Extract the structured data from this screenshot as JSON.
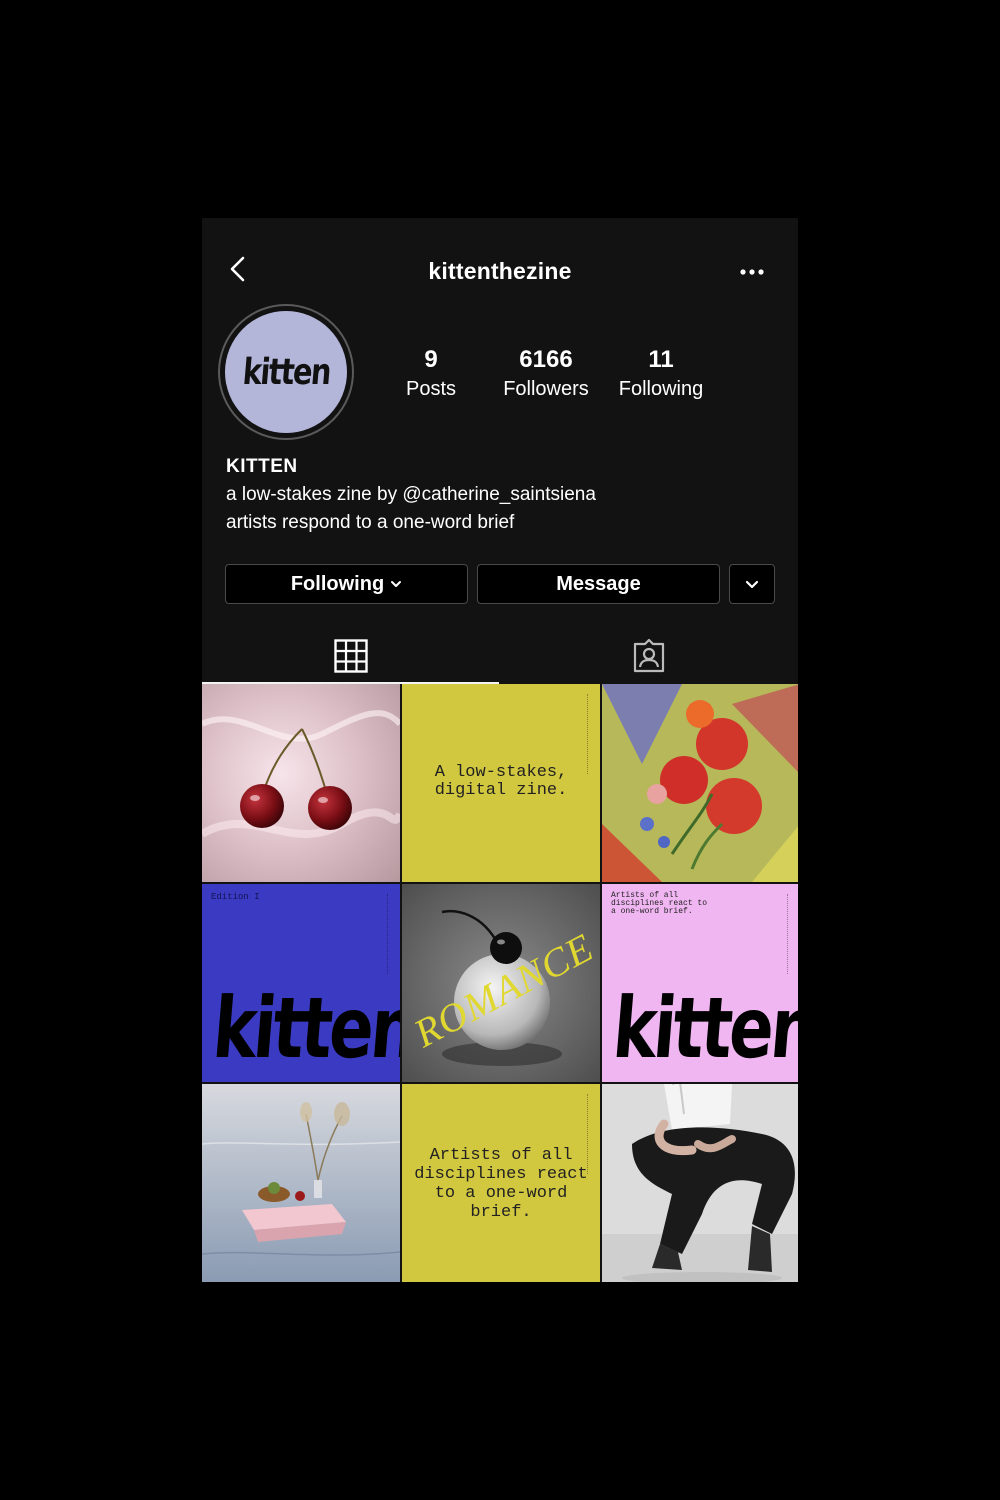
{
  "header": {
    "username": "kittenthezine",
    "back_icon": "chevron-left-icon",
    "more_icon": "more-horizontal-icon"
  },
  "profile": {
    "avatar_text": "kitten",
    "stats": [
      {
        "value": "9",
        "label": "Posts"
      },
      {
        "value": "6166",
        "label": "Followers"
      },
      {
        "value": "11",
        "label": "Following"
      }
    ],
    "name": "KITTEN",
    "bio_line1": "a low-stakes zine by @catherine_saintsiena",
    "bio_line2": "artists respond to a one-word brief"
  },
  "actions": {
    "following_label": "Following",
    "message_label": "Message"
  },
  "tabs": [
    {
      "icon": "grid-icon",
      "active": true
    },
    {
      "icon": "tagged-person-icon",
      "active": false
    }
  ],
  "posts": {
    "p2_text": "A low-stakes, digital zine.",
    "p4_edition": "Edition I",
    "p4_word": "kitten",
    "p5_word": "ROMANCE",
    "p6_text": "Artists of all disciplines react to a one-word brief.",
    "p6_word": "kitten",
    "p8_text": "Artists of all disciplines react to a one-word brief."
  },
  "colors": {
    "background": "#121212",
    "avatar_bg": "#b3b6d9",
    "yellow": "#d2c83f",
    "blue": "#3a3bc2",
    "pink": "#f0b6f2"
  }
}
